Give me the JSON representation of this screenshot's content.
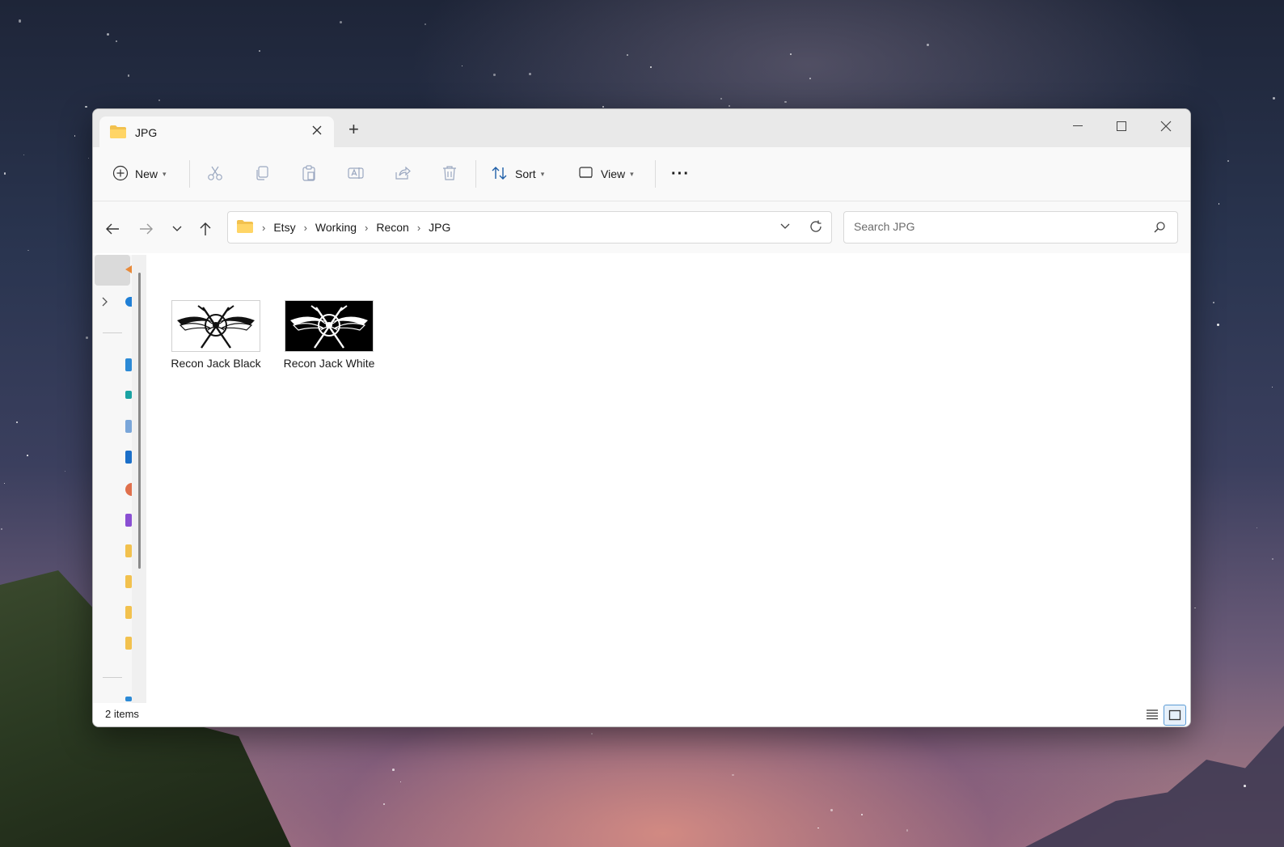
{
  "window": {
    "tab_title": "JPG",
    "newtab_label": "+"
  },
  "toolbar": {
    "new_label": "New",
    "sort_label": "Sort",
    "view_label": "View",
    "more_label": "···",
    "chevron": "⌄",
    "icons": [
      "plus-circle-icon",
      "cut-icon",
      "copy-icon",
      "paste-icon",
      "rename-icon",
      "share-icon",
      "delete-icon",
      "sort-icon",
      "view-icon",
      "more-icon"
    ]
  },
  "address": {
    "separator": "›",
    "crumbs": [
      "Etsy",
      "Working",
      "Recon",
      "JPG"
    ]
  },
  "search": {
    "placeholder": "Search JPG"
  },
  "files": [
    {
      "name": "Recon Jack Black",
      "thumb_bg": "#ffffff",
      "thumb_fg": "#111111"
    },
    {
      "name": "Recon Jack White",
      "thumb_bg": "#000000",
      "thumb_fg": "#ffffff"
    }
  ],
  "status": {
    "count_text": "2 items"
  },
  "colors": {
    "accent": "#0067c0",
    "folder": "#f2c14e"
  }
}
